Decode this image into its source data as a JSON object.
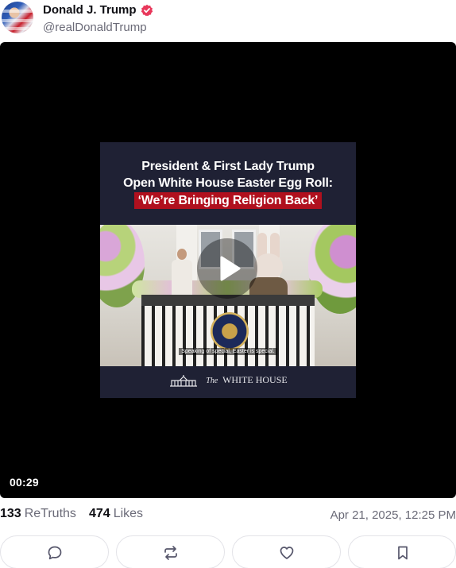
{
  "post": {
    "author_name": "Donald J. Trump",
    "author_handle": "@realDonaldTrump",
    "verified_icon": "verified-badge-icon",
    "accent_color": "#e8385b"
  },
  "video": {
    "duration": "00:29",
    "poster": {
      "headline_line1": "President & First Lady Trump",
      "headline_line2": "Open White House Easter Egg Roll:",
      "headline_highlight": "‘We’re Bringing Religion Back’",
      "subtitle": "Speaking of special, Easter is special.",
      "logo_the": "The",
      "logo_name": "WHITE HOUSE"
    },
    "play_icon": "play-icon"
  },
  "stats": {
    "retruths_count": "133",
    "retruths_label": "ReTruths",
    "likes_count": "474",
    "likes_label": "Likes",
    "timestamp": "Apr 21, 2025, 12:25 PM"
  },
  "actions": [
    {
      "name": "reply",
      "icon": "comment-icon"
    },
    {
      "name": "retruth",
      "icon": "repost-icon"
    },
    {
      "name": "like",
      "icon": "heart-icon"
    },
    {
      "name": "bookmark",
      "icon": "bookmark-icon"
    }
  ]
}
